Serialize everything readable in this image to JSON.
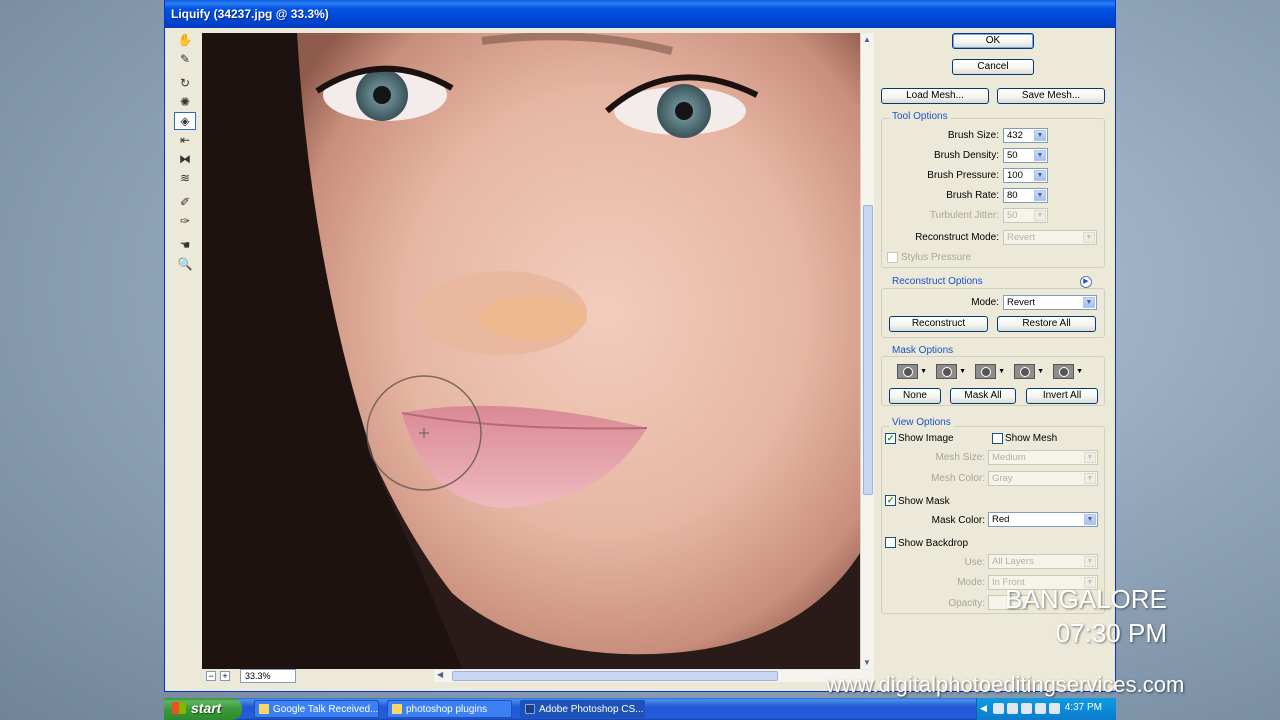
{
  "window": {
    "title": "Liquify (34237.jpg @ 33.3%)"
  },
  "tools": [
    "forward-warp-tool",
    "reconstruct-tool",
    "twirl-clockwise-tool",
    "pucker-tool",
    "bloat-tool",
    "push-left-tool",
    "mirror-tool",
    "turbulence-tool",
    "freeze-mask-tool",
    "thaw-mask-tool",
    "hand-tool",
    "zoom-tool"
  ],
  "status": {
    "zoom": "33.3%"
  },
  "buttons": {
    "ok": "OK",
    "cancel": "Cancel",
    "load_mesh": "Load Mesh...",
    "save_mesh": "Save Mesh..."
  },
  "tool_options": {
    "title": "Tool Options",
    "brush_size_label": "Brush Size:",
    "brush_size": "432",
    "brush_density_label": "Brush Density:",
    "brush_density": "50",
    "brush_pressure_label": "Brush Pressure:",
    "brush_pressure": "100",
    "brush_rate_label": "Brush Rate:",
    "brush_rate": "80",
    "turbulent_jitter_label": "Turbulent Jitter:",
    "turbulent_jitter": "50",
    "reconstruct_mode_label": "Reconstruct Mode:",
    "reconstruct_mode": "Revert",
    "stylus_pressure_label": "Stylus Pressure"
  },
  "reconstruct_options": {
    "title": "Reconstruct Options",
    "mode_label": "Mode:",
    "mode": "Revert",
    "reconstruct_btn": "Reconstruct",
    "restore_all_btn": "Restore All"
  },
  "mask_options": {
    "title": "Mask Options",
    "none_btn": "None",
    "mask_all_btn": "Mask All",
    "invert_all_btn": "Invert All"
  },
  "view_options": {
    "title": "View Options",
    "show_image_label": "Show Image",
    "show_image": true,
    "show_mesh_label": "Show Mesh",
    "show_mesh": false,
    "mesh_size_label": "Mesh Size:",
    "mesh_size": "Medium",
    "mesh_color_label": "Mesh Color:",
    "mesh_color": "Gray",
    "show_mask_label": "Show Mask",
    "show_mask": true,
    "mask_color_label": "Mask Color:",
    "mask_color": "Red",
    "show_backdrop_label": "Show Backdrop",
    "show_backdrop": false,
    "use_label": "Use:",
    "use": "All Layers",
    "mode_label": "Mode:",
    "mode": "In Front",
    "opacity_label": "Opacity:"
  },
  "overlay": {
    "city": "BANGALORE",
    "time": "07:30 PM",
    "url": "www.digitalphotoeditingservices.com"
  },
  "taskbar": {
    "start": "start",
    "tasks": [
      "Google Talk Received...",
      "photoshop plugins",
      "Adobe Photoshop CS..."
    ],
    "clock": "4:37 PM"
  }
}
